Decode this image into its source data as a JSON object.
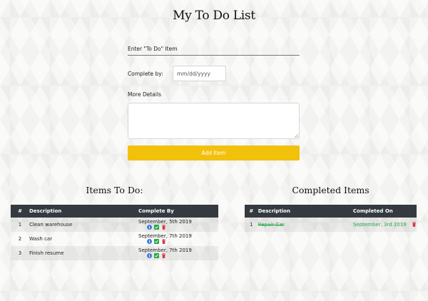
{
  "page": {
    "title": "My To Do List"
  },
  "form": {
    "todo_label": "Enter \"To Do\" Item",
    "complete_by_label": "Complete by:",
    "date_placeholder": "mm/dd/yyyy",
    "details_label": "More Details",
    "add_button_label": "Add Item"
  },
  "todo": {
    "title": "Items To Do:",
    "headers": {
      "num": "#",
      "description": "Description",
      "complete_by": "Complete By"
    },
    "rows": [
      {
        "num": "1",
        "description": "Clean warehouse",
        "date": "September, 5th 2019"
      },
      {
        "num": "2",
        "description": "Wash car",
        "date": "September, 7th 2019"
      },
      {
        "num": "3",
        "description": "Finish resume",
        "date": "September, 7th 2019"
      }
    ]
  },
  "completed": {
    "title": "Completed Items",
    "headers": {
      "num": "#",
      "description": "Description",
      "completed_on": "Completed On"
    },
    "rows": [
      {
        "num": "1",
        "description": "Repair Car",
        "date": "September, 3rd 2019"
      }
    ]
  },
  "colors": {
    "accent": "#f2c10c",
    "table_header": "#343a40",
    "info": "#3b7ddd",
    "check": "#28a745",
    "delete": "#dc3545"
  }
}
